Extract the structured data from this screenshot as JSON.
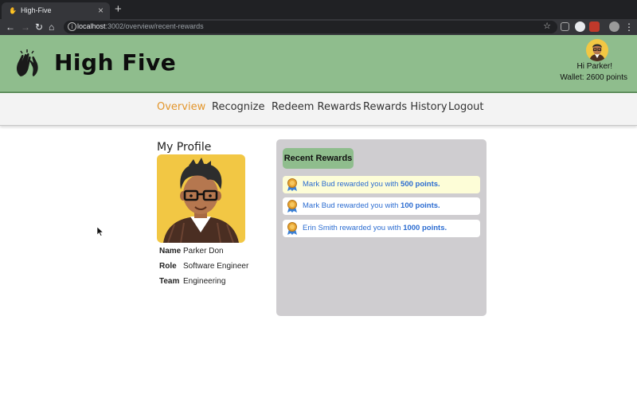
{
  "browser": {
    "tab_title": "High-Five",
    "url_host": "localhost",
    "url_rest": ":3002/overview/recent-rewards"
  },
  "header": {
    "brand": "High Five",
    "greeting": "Hi Parker!",
    "wallet": "Wallet: 2600 points"
  },
  "nav": {
    "items": [
      "Overview",
      "Recognize",
      "Redeem Rewards",
      "Rewards History",
      "Logout"
    ],
    "active": "Overview"
  },
  "profile": {
    "title": "My Profile",
    "fields": [
      {
        "label": "Name",
        "value": "Parker Don"
      },
      {
        "label": "Role",
        "value": "Software Engineer"
      },
      {
        "label": "Team",
        "value": "Engineering"
      }
    ]
  },
  "rewards": {
    "title": "Recent Rewards",
    "items": [
      {
        "text": "Mark Bud rewarded you with ",
        "points": "500 points.",
        "highlighted": true
      },
      {
        "text": "Mark Bud rewarded you with ",
        "points": "100 points.",
        "highlighted": false
      },
      {
        "text": "Erin Smith rewarded you with ",
        "points": "1000 points.",
        "highlighted": false
      }
    ]
  },
  "colors": {
    "header_bg": "#8fbd8d",
    "active_nav": "#e3962c",
    "reward_text": "#2b6cd1",
    "panel_bg": "#cfcdd0"
  }
}
